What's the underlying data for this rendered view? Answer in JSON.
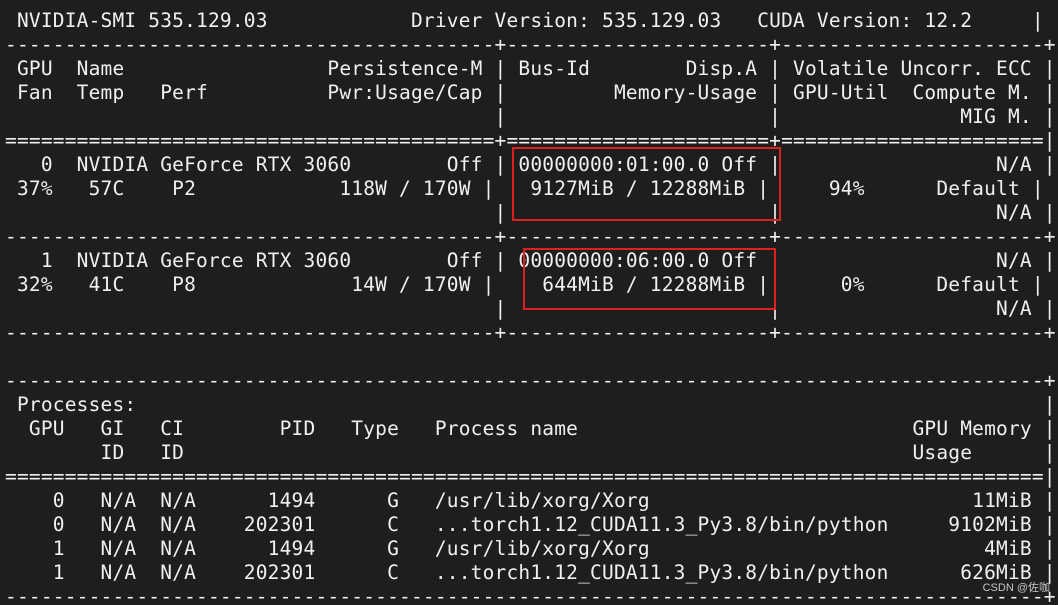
{
  "terminal": {
    "lines": [
      " NVIDIA-SMI 535.129.03            Driver Version: 535.129.03   CUDA Version: 12.2     |",
      "-----------------------------------------+----------------------+----------------------+",
      " GPU  Name                 Persistence-M | Bus-Id        Disp.A | Volatile Uncorr. ECC |",
      " Fan  Temp   Perf          Pwr:Usage/Cap |         Memory-Usage | GPU-Util  Compute M. |",
      "                                         |                      |               MIG M. |",
      "=========================================+======================+======================|",
      "   0  NVIDIA GeForce RTX 3060        Off | 00000000:01:00.0 Off |                  N/A |",
      " 37%   57C    P2            118W / 170W |   9127MiB / 12288MiB |     94%      Default |",
      "                                         |                      |                  N/A |",
      "-----------------------------------------+----------------------+----------------------+",
      "   1  NVIDIA GeForce RTX 3060        Off | 00000000:06:00.0 Off |                  N/A |",
      " 32%   41C    P8             14W / 170W |    644MiB / 12288MiB |      0%      Default |",
      "                                         |                      |                  N/A |",
      "-----------------------------------------+----------------------+----------------------+",
      "",
      "                                                                                       ",
      "---------------------------------------------------------------------------------------+",
      " Processes:                                                                            |",
      "  GPU   GI   CI        PID   Type   Process name                            GPU Memory |",
      "        ID   ID                                                             Usage      |",
      "=======================================================================================|",
      "    0   N/A  N/A      1494      G   /usr/lib/xorg/Xorg                           11MiB |",
      "    0   N/A  N/A    202301      C   ...torch1.12_CUDA11.3_Py3.8/bin/python     9102MiB |",
      "    1   N/A  N/A      1494      G   /usr/lib/xorg/Xorg                            4MiB |",
      "    1   N/A  N/A    202301      C   ...torch1.12_CUDA11.3_Py3.8/bin/python      626MiB |",
      "---------------------------------------------------------------------------------------+"
    ]
  },
  "watermark": "CSDN @佐咖",
  "colors": {
    "background": "#1e1e1e",
    "text": "#f0f0f0",
    "highlight": "#e02020"
  }
}
